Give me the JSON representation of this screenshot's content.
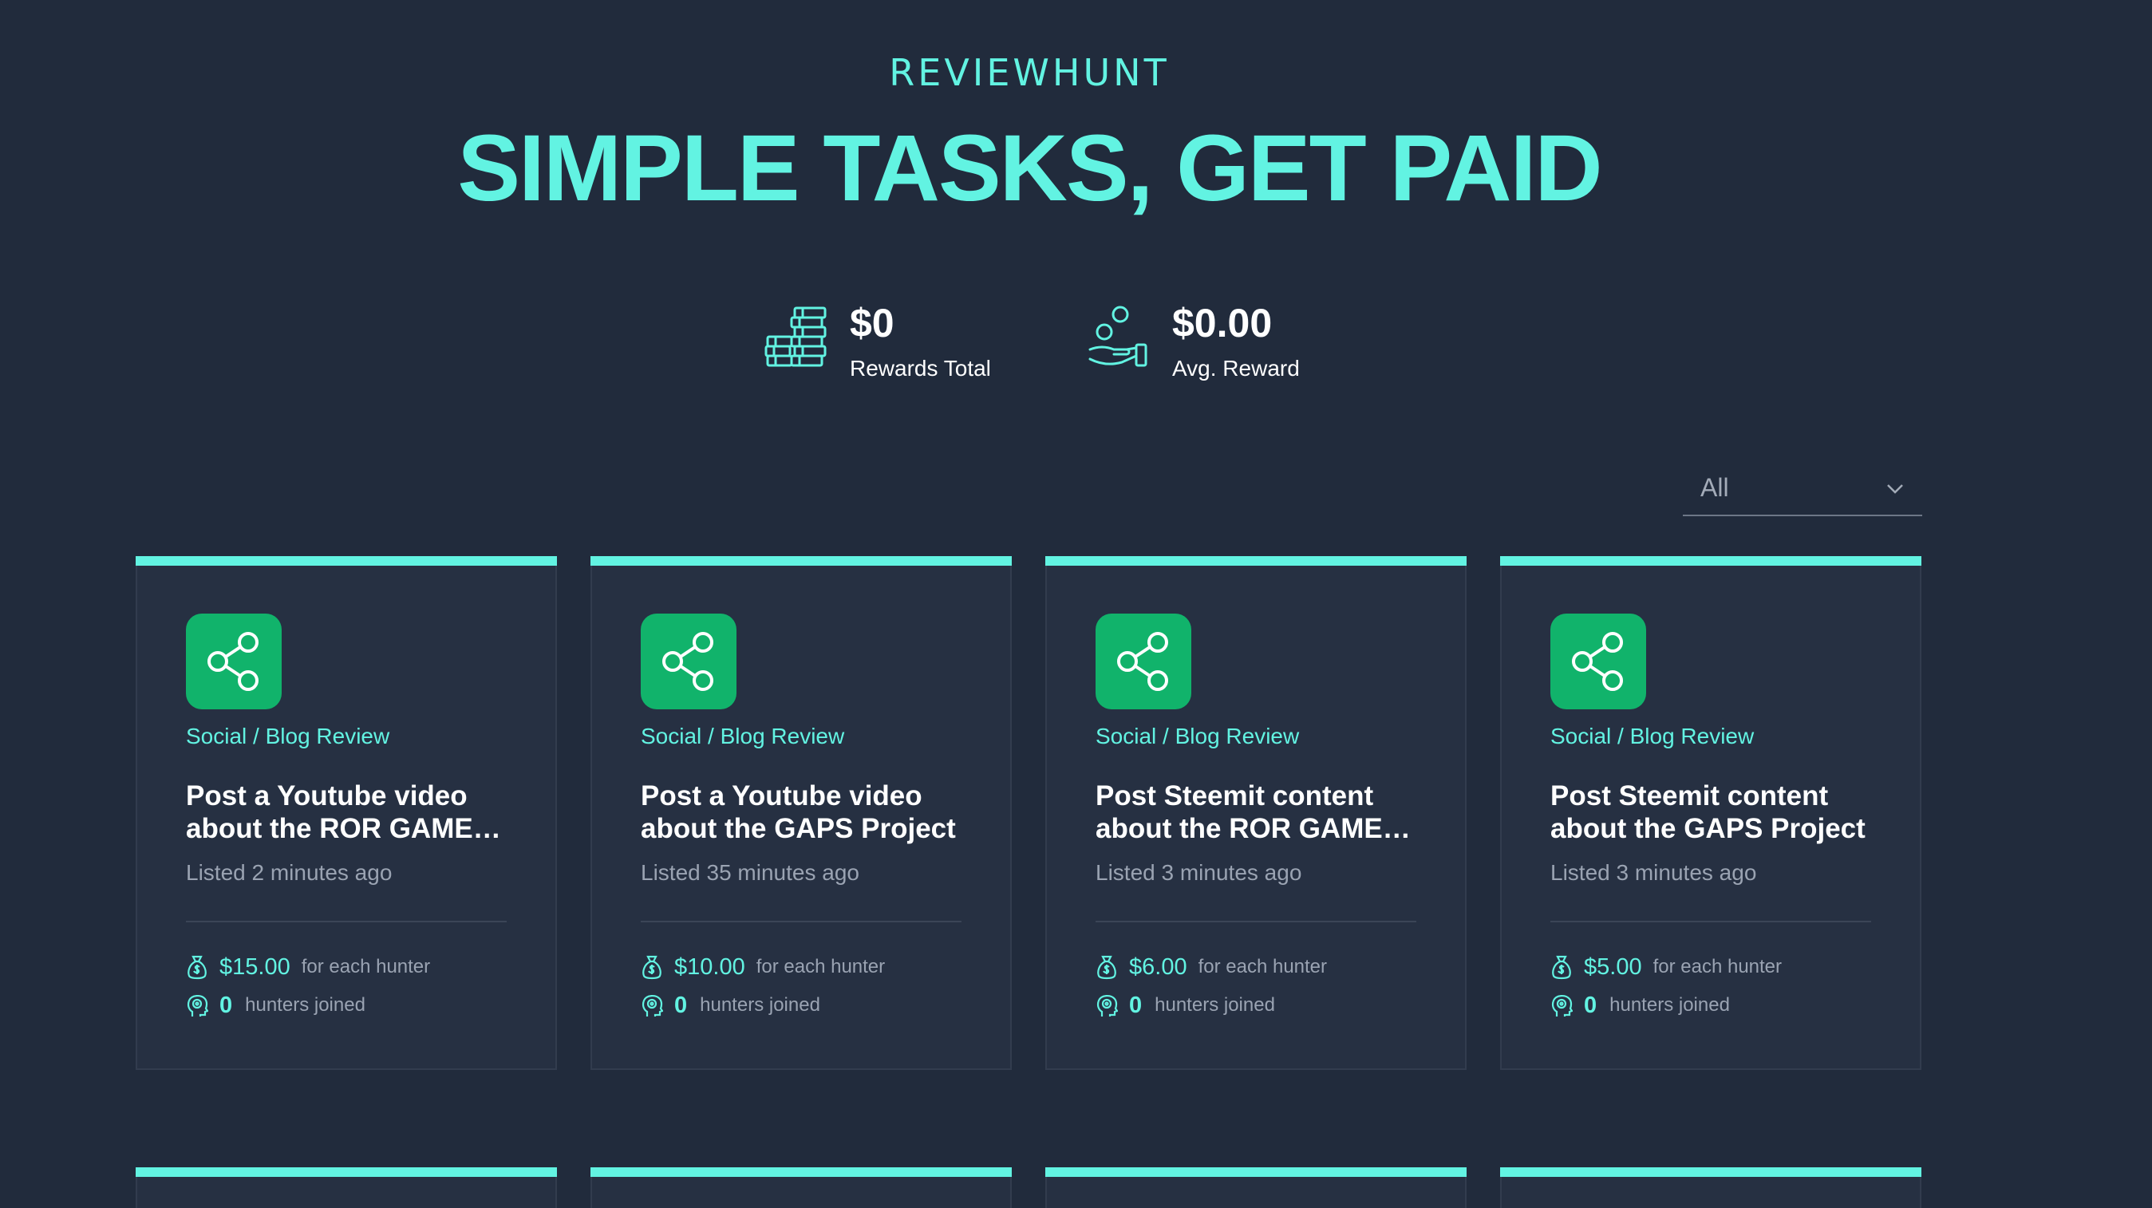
{
  "brand": "REVIEWHUNT",
  "headline": "SIMPLE TASKS, GET PAID",
  "stats": {
    "rewards_total": {
      "value": "$0",
      "label": "Rewards Total",
      "icon": "coin-stack-icon"
    },
    "avg_reward": {
      "value": "$0.00",
      "label": "Avg. Reward",
      "icon": "hand-coins-icon"
    }
  },
  "filter": {
    "selected": "All",
    "icon": "chevron-down-icon"
  },
  "colors": {
    "accent": "#62f3e2",
    "background": "#212b3c",
    "card": "#263042",
    "icon_bg": "#11b36b"
  },
  "cards": [
    {
      "category": "Social / Blog Review",
      "title_line1": "Post a Youtube video",
      "title_line2": "about the ROR GAME…",
      "listed": "Listed 2 minutes ago",
      "price": "$15.00",
      "price_suffix": "for each hunter",
      "hunters": "0",
      "hunters_suffix": "hunters joined",
      "icon": "share-icon"
    },
    {
      "category": "Social / Blog Review",
      "title_line1": "Post a Youtube video",
      "title_line2": "about the GAPS Project",
      "listed": "Listed 35 minutes ago",
      "price": "$10.00",
      "price_suffix": "for each hunter",
      "hunters": "0",
      "hunters_suffix": "hunters joined",
      "icon": "share-icon"
    },
    {
      "category": "Social / Blog Review",
      "title_line1": "Post Steemit content",
      "title_line2": "about the ROR GAME…",
      "listed": "Listed 3 minutes ago",
      "price": "$6.00",
      "price_suffix": "for each hunter",
      "hunters": "0",
      "hunters_suffix": "hunters joined",
      "icon": "share-icon"
    },
    {
      "category": "Social / Blog Review",
      "title_line1": "Post Steemit content",
      "title_line2": "about the GAPS Project",
      "listed": "Listed 3 minutes ago",
      "price": "$5.00",
      "price_suffix": "for each hunter",
      "hunters": "0",
      "hunters_suffix": "hunters joined",
      "icon": "share-icon"
    }
  ]
}
